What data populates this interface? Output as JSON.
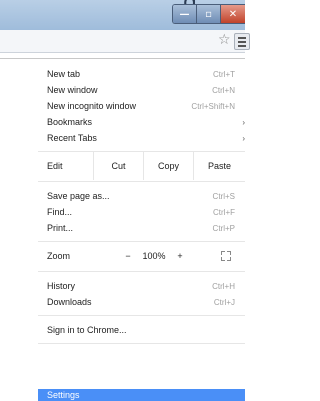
{
  "window": {
    "title_fragment": "g",
    "buttons": [
      "—",
      "▫",
      "✕"
    ]
  },
  "toolbar": {
    "star_icon": "star-icon",
    "menu_icon": "hamburger-menu-icon"
  },
  "menu": {
    "group1": [
      {
        "label": "New tab",
        "shortcut": "Ctrl+T"
      },
      {
        "label": "New window",
        "shortcut": "Ctrl+N"
      },
      {
        "label": "New incognito window",
        "shortcut": "Ctrl+Shift+N"
      },
      {
        "label": "Bookmarks",
        "submenu": true
      },
      {
        "label": "Recent Tabs",
        "submenu": true
      }
    ],
    "edit_row": {
      "label": "Edit",
      "cut": "Cut",
      "copy": "Copy",
      "paste": "Paste"
    },
    "group2": [
      {
        "label": "Save page as...",
        "shortcut": "Ctrl+S"
      },
      {
        "label": "Find...",
        "shortcut": "Ctrl+F"
      },
      {
        "label": "Print...",
        "shortcut": "Ctrl+P"
      }
    ],
    "zoom_row": {
      "label": "Zoom",
      "minus": "−",
      "value": "100%",
      "plus": "+"
    },
    "group3": [
      {
        "label": "History",
        "shortcut": "Ctrl+H"
      },
      {
        "label": "Downloads",
        "shortcut": "Ctrl+J"
      }
    ],
    "signin": {
      "label": "Sign in to Chrome..."
    },
    "settings": {
      "label": "Settings"
    }
  },
  "colors": {
    "selected_bg": "#4a8ff7",
    "close_button": "#c0432b",
    "frame": "#9fbcdb"
  }
}
